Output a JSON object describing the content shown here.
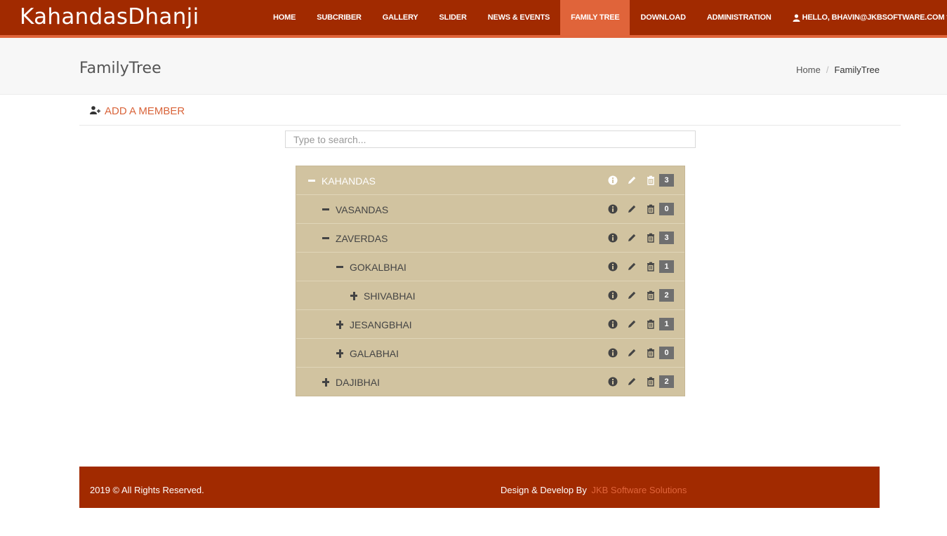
{
  "brand": "KahandasDhanji",
  "nav": {
    "items": [
      {
        "label": "HOME",
        "active": false
      },
      {
        "label": "SUBCRIBER",
        "active": false
      },
      {
        "label": "GALLERY",
        "active": false
      },
      {
        "label": "SLIDER",
        "active": false
      },
      {
        "label": "NEWS & EVENTS",
        "active": false
      },
      {
        "label": "FAMILY TREE",
        "active": true
      },
      {
        "label": "DOWNLOAD",
        "active": false
      },
      {
        "label": "ADMINISTRATION",
        "active": false
      }
    ],
    "user": {
      "label": "HELLO, BHAVIN@JKBSOFTWARE.COM",
      "icon": "user-icon",
      "dropdown_icon": "chevron-down-icon"
    }
  },
  "page": {
    "title": "FamilyTree",
    "breadcrumb": {
      "home": "Home",
      "separator": "/",
      "current": "FamilyTree"
    }
  },
  "add_member": {
    "label": "ADD A MEMBER",
    "icon": "user-plus-icon"
  },
  "search": {
    "placeholder": "Type to search...",
    "value": ""
  },
  "tree": {
    "colors": {
      "background": "#d1c3a0",
      "badge": "#6f6f6f"
    },
    "rows": [
      {
        "name": "KAHANDAS",
        "level": 0,
        "state": "expanded",
        "count": "3"
      },
      {
        "name": "VASANDAS",
        "level": 1,
        "state": "expanded",
        "count": "0"
      },
      {
        "name": "ZAVERDAS",
        "level": 1,
        "state": "expanded",
        "count": "3"
      },
      {
        "name": "GOKALBHAI",
        "level": 2,
        "state": "expanded",
        "count": "1"
      },
      {
        "name": "SHIVABHAI",
        "level": 3,
        "state": "collapsed",
        "count": "2"
      },
      {
        "name": "JESANGBHAI",
        "level": 2,
        "state": "collapsed",
        "count": "1"
      },
      {
        "name": "GALABHAI",
        "level": 2,
        "state": "collapsed",
        "count": "0"
      },
      {
        "name": "DAJIBHAI",
        "level": 1,
        "state": "collapsed",
        "count": "2"
      }
    ],
    "row_icons": [
      "info-icon",
      "pencil-icon",
      "trash-icon"
    ]
  },
  "footer": {
    "copyright": "2019 © All Rights Reserved.",
    "credit_prefix": "Design & Develop By",
    "credit_link": "JKB Software Solutions"
  },
  "theme": {
    "primary": "#a12a00",
    "accent": "#e0643a"
  }
}
